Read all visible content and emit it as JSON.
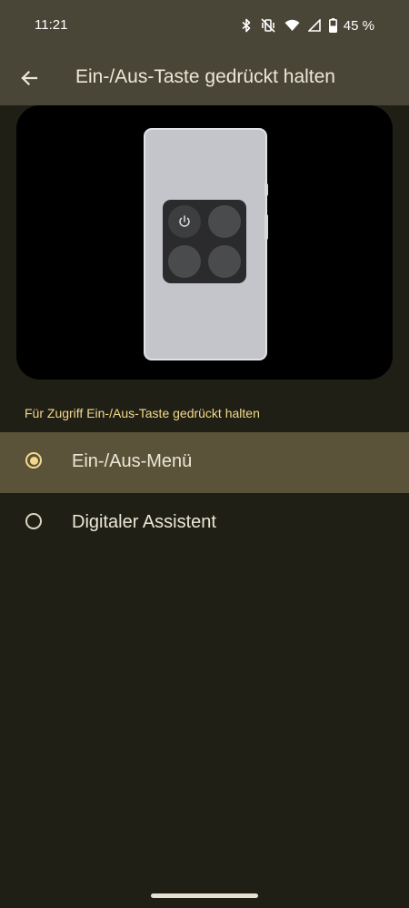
{
  "status_bar": {
    "time": "11:21",
    "battery": "45 %",
    "icons": [
      "bluetooth-icon",
      "vibrate-off-icon",
      "wifi-icon",
      "signal-icon",
      "battery-icon"
    ]
  },
  "app_bar": {
    "back_icon": "arrow-back-icon",
    "title": "Ein-/Aus-Taste gedrückt halten"
  },
  "illustration": {
    "description_icon": "power-icon"
  },
  "section": {
    "header": "Für Zugriff Ein-/Aus-Taste gedrückt halten"
  },
  "options": [
    {
      "label": "Ein-/Aus-Menü",
      "selected": true
    },
    {
      "label": "Digitaler Assistent",
      "selected": false
    }
  ],
  "colors": {
    "background": "#201f15",
    "app_bar": "#4a4637",
    "accent": "#f3d98c",
    "selected_row": "#5b5339"
  }
}
